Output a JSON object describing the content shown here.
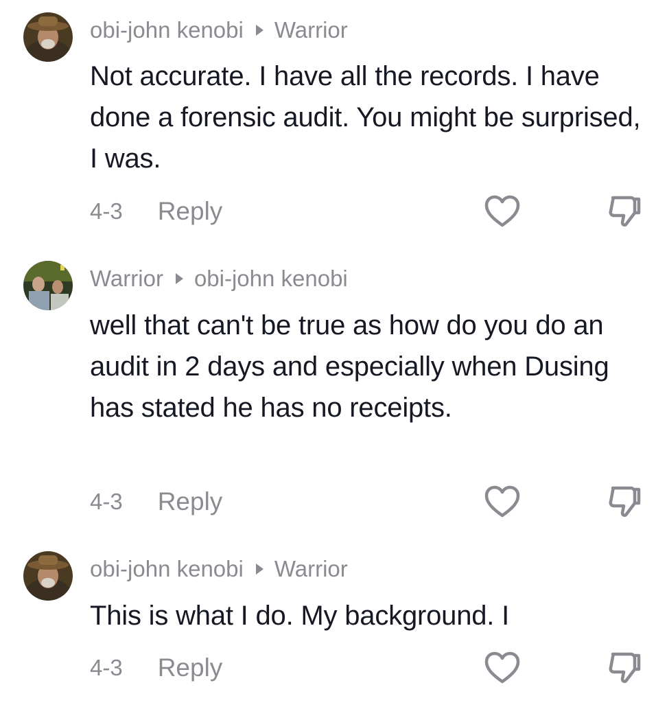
{
  "comments": [
    {
      "author": "obi-john kenobi",
      "reply_to": "Warrior",
      "text": "Not accurate. I have all the records. I have done a forensic audit. You might be surprised, I was.",
      "date": "4-3",
      "reply_label": "Reply",
      "like_icon": "heart-outline-icon",
      "dislike_icon": "thumbs-down-icon"
    },
    {
      "author": "Warrior",
      "reply_to": "obi-john kenobi",
      "text": "well that can't be true as how do you do an audit in 2 days and especially when Dusing has stated he has no receipts.",
      "date": "4-3",
      "reply_label": "Reply",
      "like_icon": "heart-outline-icon",
      "dislike_icon": "thumbs-down-icon"
    },
    {
      "author": "obi-john kenobi",
      "reply_to": "Warrior",
      "text": "This is what I do. My background. I",
      "date": "4-3",
      "reply_label": "Reply",
      "like_icon": "heart-outline-icon",
      "dislike_icon": "thumbs-down-icon"
    }
  ],
  "colors": {
    "primary_text": "#161823",
    "secondary_text": "#8a8b91",
    "icon_stroke": "#8a8b91",
    "background": "#ffffff"
  }
}
